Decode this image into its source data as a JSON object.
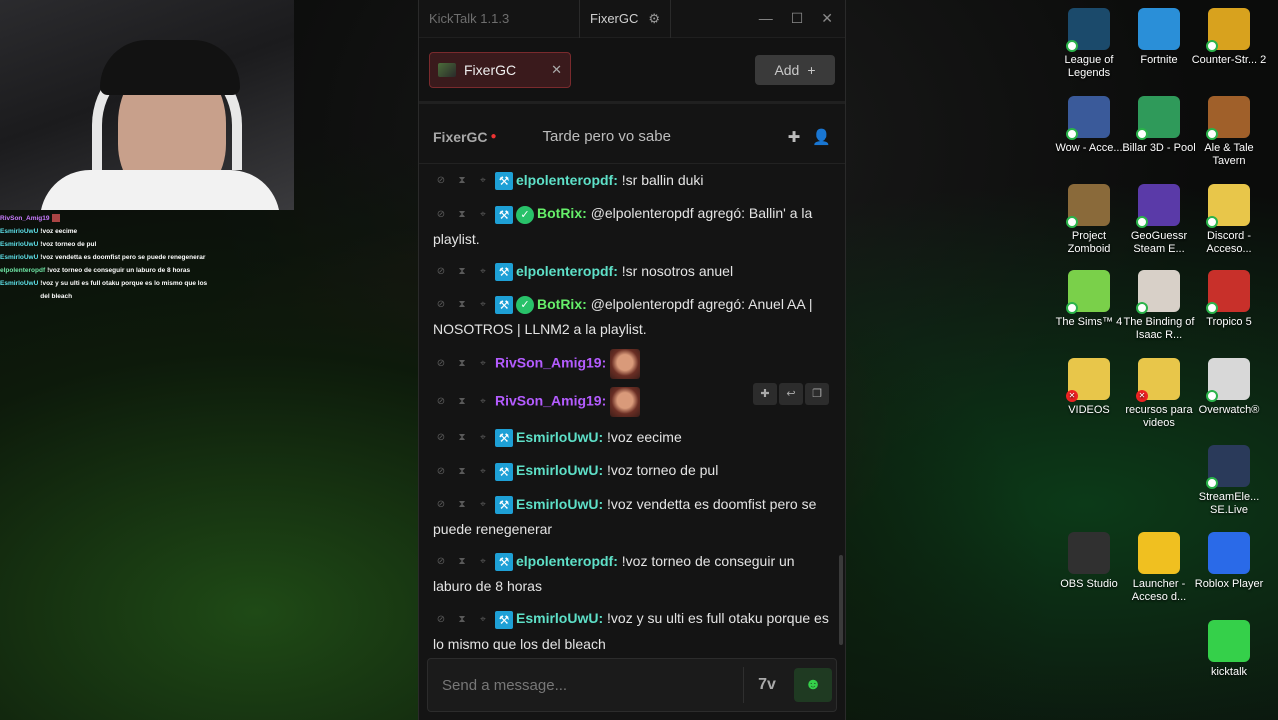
{
  "overlay_chat": [
    {
      "user": "RivSon_Amig19",
      "text": "",
      "color": "#c97cff"
    },
    {
      "user": "EsmirloUwU",
      "text": "!voz eecime",
      "color": "#5ee0e8"
    },
    {
      "user": "EsmirloUwU",
      "text": "!voz torneo de pul",
      "color": "#5ee0e8"
    },
    {
      "user": "EsmirloUwU",
      "text": "!voz vendetta es doomfist pero se puede renegenerar",
      "color": "#5ee0e8"
    },
    {
      "user": "elpolenteropdf",
      "text": "!voz torneo de conseguir un laburo de 8 horas",
      "color": "#6ee6a4"
    },
    {
      "user": "EsmirloUwU",
      "text": "!voz y su ulti es full otaku porque es lo mismo que los del bleach",
      "color": "#5ee0e8"
    }
  ],
  "app": {
    "title": "KickTalk 1.1.3",
    "account": "FixerGC",
    "tab_label": "FixerGC",
    "add_label": "Add",
    "channel_name": "FixerGC",
    "stream_title": "Tarde pero vo sabe",
    "input_placeholder": "Send a message..."
  },
  "messages": [
    {
      "user": "elpolenteropdf",
      "color": "teal",
      "text": "!sr ballin duki",
      "verified": false
    },
    {
      "user": "BotRix",
      "color": "green",
      "text": "@elpolenteropdf agregó: Ballin' a la playlist.",
      "verified": true
    },
    {
      "user": "elpolenteropdf",
      "color": "teal",
      "text": "!sr nosotros anuel",
      "verified": false
    },
    {
      "user": "BotRix",
      "color": "green",
      "text": "@elpolenteropdf agregó: Anuel AA | NOSOTROS | LLNM2 a la playlist.",
      "verified": true
    },
    {
      "user": "RivSon_Amig19",
      "color": "purple",
      "text": "",
      "emote": true
    },
    {
      "user": "RivSon_Amig19",
      "color": "purple",
      "text": "",
      "emote": true
    },
    {
      "user": "EsmirloUwU",
      "color": "teal",
      "text": "!voz eecime"
    },
    {
      "user": "EsmirloUwU",
      "color": "teal",
      "text": "!voz torneo de pul"
    },
    {
      "user": "EsmirloUwU",
      "color": "teal",
      "text": "!voz vendetta es doomfist pero se puede renegenerar"
    },
    {
      "user": "elpolenteropdf",
      "color": "teal",
      "text": "!voz torneo de conseguir un laburo de 8 horas"
    },
    {
      "user": "EsmirloUwU",
      "color": "teal",
      "text": "!voz y su ulti es full otaku porque es lo mismo que los del bleach"
    }
  ],
  "desktop_icons": [
    {
      "label": "League of Legends",
      "color": "#1b4a6b",
      "status": "ok"
    },
    {
      "label": "Fortnite",
      "color": "#2a8fd8",
      "status": "none"
    },
    {
      "label": "Counter-Str... 2",
      "color": "#d8a21e",
      "status": "ok"
    },
    {
      "label": "Wow - Acce...",
      "color": "#3a5a9a",
      "status": "ok"
    },
    {
      "label": "Billar 3D - Pool",
      "color": "#2f9a5a",
      "status": "ok"
    },
    {
      "label": "Ale & Tale Tavern",
      "color": "#a0602a",
      "status": "ok"
    },
    {
      "label": "Project Zomboid",
      "color": "#8a6a3a",
      "status": "ok"
    },
    {
      "label": "GeoGuessr Steam E...",
      "color": "#5a3aa8",
      "status": "ok"
    },
    {
      "label": "Discord - Acceso...",
      "color": "#e8c64a",
      "status": "ok"
    },
    {
      "label": "The Sims™ 4",
      "color": "#7ad04a",
      "status": "ok"
    },
    {
      "label": "The Binding of Isaac R...",
      "color": "#d8d0c8",
      "status": "ok"
    },
    {
      "label": "Tropico 5",
      "color": "#c8302a",
      "status": "ok"
    },
    {
      "label": "VIDEOS",
      "color": "#e8c64a",
      "status": "bad"
    },
    {
      "label": "recursos para videos",
      "color": "#e8c64a",
      "status": "bad"
    },
    {
      "label": "Overwatch®",
      "color": "#d8d8d8",
      "status": "ok"
    },
    {
      "label": "StreamEle... SE.Live",
      "color": "#2a3a5a",
      "status": "ok"
    },
    {
      "label": "OBS Studio",
      "color": "#303030",
      "status": "none"
    },
    {
      "label": "Launcher - Acceso d...",
      "color": "#f0c020",
      "status": "none"
    },
    {
      "label": "Roblox Player",
      "color": "#2a6ae8",
      "status": "none"
    },
    {
      "label": "kicktalk",
      "color": "#35d04a",
      "status": "none"
    }
  ]
}
